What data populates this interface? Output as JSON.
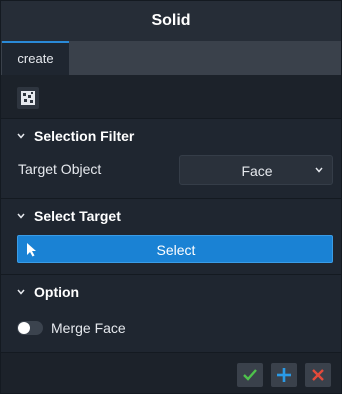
{
  "window": {
    "title": "Solid"
  },
  "tabs": [
    {
      "label": "create",
      "active": true
    }
  ],
  "toolbar": {
    "icon": "select-mode-icon"
  },
  "sections": {
    "selection_filter": {
      "title": "Selection Filter",
      "target_object_label": "Target Object",
      "target_object_value": "Face"
    },
    "select_target": {
      "title": "Select Target",
      "select_label": "Select"
    },
    "option": {
      "title": "Option",
      "merge_face_label": "Merge Face",
      "merge_face_on": false
    }
  },
  "footer": {
    "buttons": [
      "confirm-icon",
      "add-icon",
      "cancel-icon"
    ]
  },
  "colors": {
    "accent": "#1a82d4",
    "confirm": "#4ec24b",
    "add": "#2a9ae6",
    "cancel": "#e24a3b"
  }
}
